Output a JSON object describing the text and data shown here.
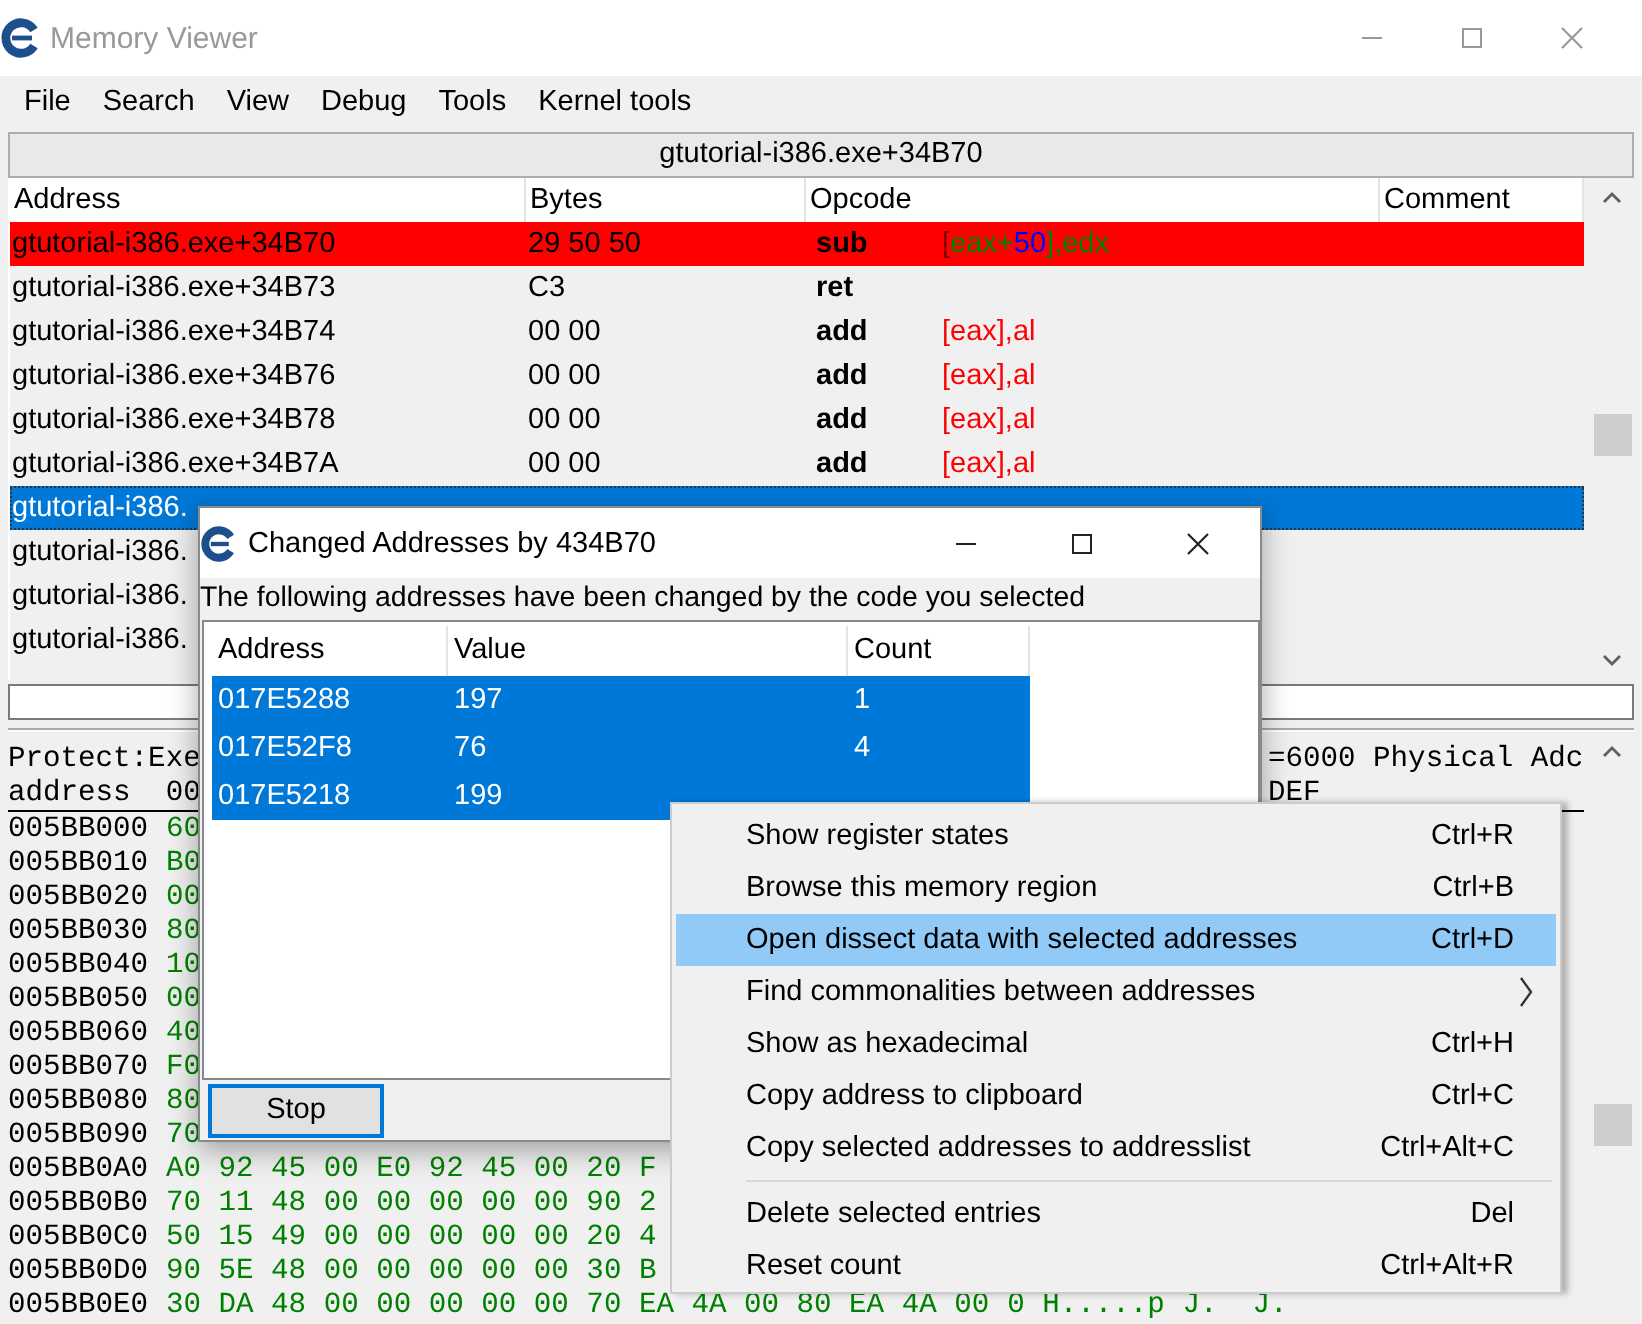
{
  "window": {
    "title": "Memory Viewer"
  },
  "menu": [
    "File",
    "Search",
    "View",
    "Debug",
    "Tools",
    "Kernel tools"
  ],
  "address_bar": "gtutorial-i386.exe+34B70",
  "disassembly": {
    "columns": [
      "Address",
      "Bytes",
      "Opcode",
      "Comment"
    ],
    "rows": [
      {
        "address": "gtutorial-i386.exe+34B70",
        "bytes": "29 50 50",
        "opcode": "sub",
        "args": [
          {
            "text": "[",
            "color": "#800000"
          },
          {
            "text": "eax+",
            "color": "#008000"
          },
          {
            "text": "50",
            "color": "#0000ff"
          },
          {
            "text": "],edx",
            "color": "#008000"
          }
        ],
        "breakpoint": true,
        "selected": false
      },
      {
        "address": "gtutorial-i386.exe+34B73",
        "bytes": "C3",
        "opcode": "ret",
        "breakpoint": false,
        "selected": false
      },
      {
        "address": "gtutorial-i386.exe+34B74",
        "bytes": "00 00",
        "opcode": "add",
        "args": [
          {
            "text": "[eax],al",
            "color": "#ff0000"
          }
        ],
        "breakpoint": false,
        "selected": false
      },
      {
        "address": "gtutorial-i386.exe+34B76",
        "bytes": "00 00",
        "opcode": "add",
        "args": [
          {
            "text": "[eax],al",
            "color": "#ff0000"
          }
        ],
        "breakpoint": false,
        "selected": false
      },
      {
        "address": "gtutorial-i386.exe+34B78",
        "bytes": "00 00",
        "opcode": "add",
        "args": [
          {
            "text": "[eax],al",
            "color": "#ff0000"
          }
        ],
        "breakpoint": false,
        "selected": false
      },
      {
        "address": "gtutorial-i386.exe+34B7A",
        "bytes": "00 00",
        "opcode": "add",
        "args": [
          {
            "text": "[eax],al",
            "color": "#ff0000"
          }
        ],
        "breakpoint": false,
        "selected": false
      },
      {
        "address": "gtutorial-i386.",
        "breakpoint": false,
        "selected": true
      },
      {
        "address": "gtutorial-i386.",
        "breakpoint": false,
        "selected": false
      },
      {
        "address": "gtutorial-i386.",
        "breakpoint": false,
        "selected": false
      },
      {
        "address": "gtutorial-i386.",
        "breakpoint": false,
        "selected": false
      }
    ]
  },
  "hex_view": {
    "header": [
      {
        "left": "Protect:Exe",
        "right": "=6000 Physical Adc"
      },
      {
        "left": "address  00",
        "right": "DEF"
      }
    ],
    "rows": [
      {
        "address": "005BB000",
        "bytes": "60"
      },
      {
        "address": "005BB010",
        "bytes": "B0"
      },
      {
        "address": "005BB020",
        "bytes": "00"
      },
      {
        "address": "005BB030",
        "bytes": "80"
      },
      {
        "address": "005BB040",
        "bytes": "10"
      },
      {
        "address": "005BB050",
        "bytes": "00"
      },
      {
        "address": "005BB060",
        "bytes": "40"
      },
      {
        "address": "005BB070",
        "bytes": "F0"
      },
      {
        "address": "005BB080",
        "bytes": "80"
      },
      {
        "address": "005BB090",
        "bytes": "70"
      },
      {
        "address": "005BB0A0",
        "bytes": "A0 92 45 00 E0 92 45 00 20 F"
      },
      {
        "address": "005BB0B0",
        "bytes": "70 11 48 00 00 00 00 00 90 2"
      },
      {
        "address": "005BB0C0",
        "bytes": "50 15 49 00 00 00 00 00 20 4"
      },
      {
        "address": "005BB0D0",
        "bytes": "90 5E 48 00 00 00 00 00 30 B"
      },
      {
        "address": "005BB0E0",
        "bytes": "30 DA 48 00 00 00 00 00 70 EA 4A 00 80 EA 4A 00",
        "ascii": "0 H.....p J.  J."
      }
    ]
  },
  "dialog": {
    "title": "Changed Addresses by 434B70",
    "message": "The following addresses have been changed by the code you selected",
    "columns": [
      "Address",
      "Value",
      "Count"
    ],
    "rows": [
      {
        "address": "017E5288",
        "value": "197",
        "count": "1",
        "selected": true
      },
      {
        "address": "017E52F8",
        "value": "76",
        "count": "4",
        "selected": true
      },
      {
        "address": "017E5218",
        "value": "199",
        "selected": true
      }
    ],
    "button": "Stop"
  },
  "context_menu": {
    "items": [
      {
        "kind": "item",
        "label": "Show register states",
        "shortcut": "Ctrl+R",
        "selected": false,
        "submenu": false
      },
      {
        "kind": "item",
        "label": "Browse this memory region",
        "shortcut": "Ctrl+B",
        "selected": false,
        "submenu": false
      },
      {
        "kind": "item",
        "label": "Open dissect data with selected addresses",
        "shortcut": "Ctrl+D",
        "selected": true,
        "submenu": false
      },
      {
        "kind": "item",
        "label": "Find commonalities between addresses",
        "selected": false,
        "submenu": true
      },
      {
        "kind": "item",
        "label": "Show as hexadecimal",
        "shortcut": "Ctrl+H",
        "selected": false,
        "submenu": false
      },
      {
        "kind": "item",
        "label": "Copy address to clipboard",
        "shortcut": "Ctrl+C",
        "selected": false,
        "submenu": false
      },
      {
        "kind": "item",
        "label": "Copy selected addresses to addresslist",
        "shortcut": "Ctrl+Alt+C",
        "selected": false,
        "submenu": false
      },
      {
        "kind": "separator"
      },
      {
        "kind": "item",
        "label": "Delete selected entries",
        "shortcut": "Del",
        "selected": false,
        "submenu": false
      },
      {
        "kind": "item",
        "label": "Reset count",
        "shortcut": "Ctrl+Alt+R",
        "selected": false,
        "submenu": false
      }
    ]
  }
}
